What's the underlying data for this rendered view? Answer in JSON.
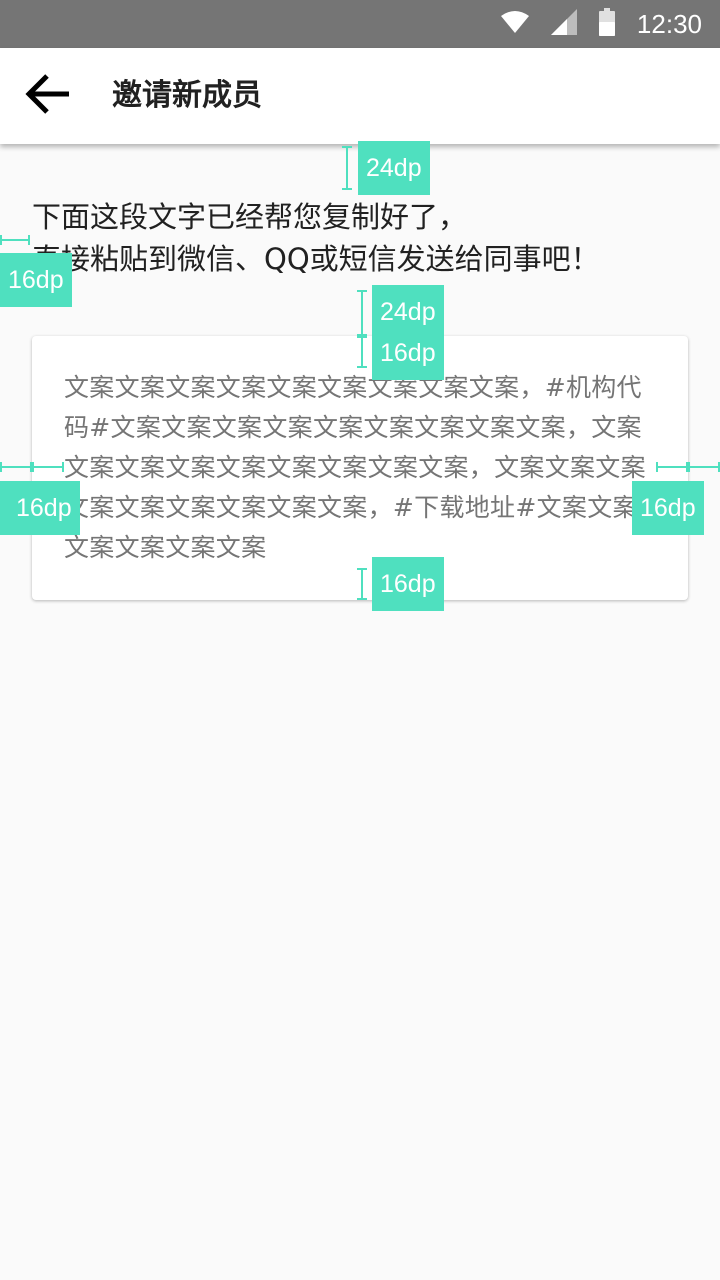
{
  "status_bar": {
    "time": "12:30",
    "icons": [
      "wifi-icon",
      "cellular-signal-icon",
      "battery-icon"
    ],
    "background": "#757575"
  },
  "app_bar": {
    "title": "邀请新成员",
    "back_icon": "arrow-left-icon",
    "background": "#ffffff"
  },
  "intro": {
    "line1": "下面这段文字已经帮您复制好了，",
    "line2": "直接粘贴到微信、QQ或短信发送给同事吧！"
  },
  "card": {
    "text": "文案文案文案文案文案文案文案文案文案，#机构代码#文案文案文案文案文案文案文案文案文案，文案文案文案文案文案文案文案文案文案，文案文案文案文案文案文案文案文案文案，#下载地址#文案文案文案文案文案文案"
  },
  "spec_annotations": {
    "accent": "#4fe0bf",
    "top_gap": "24dp",
    "left_margin": "16dp",
    "card_gap": "24dp",
    "card_top_padding": "16dp",
    "card_left_padding": "16dp",
    "card_right_padding": "16dp",
    "card_bottom_padding": "16dp"
  }
}
